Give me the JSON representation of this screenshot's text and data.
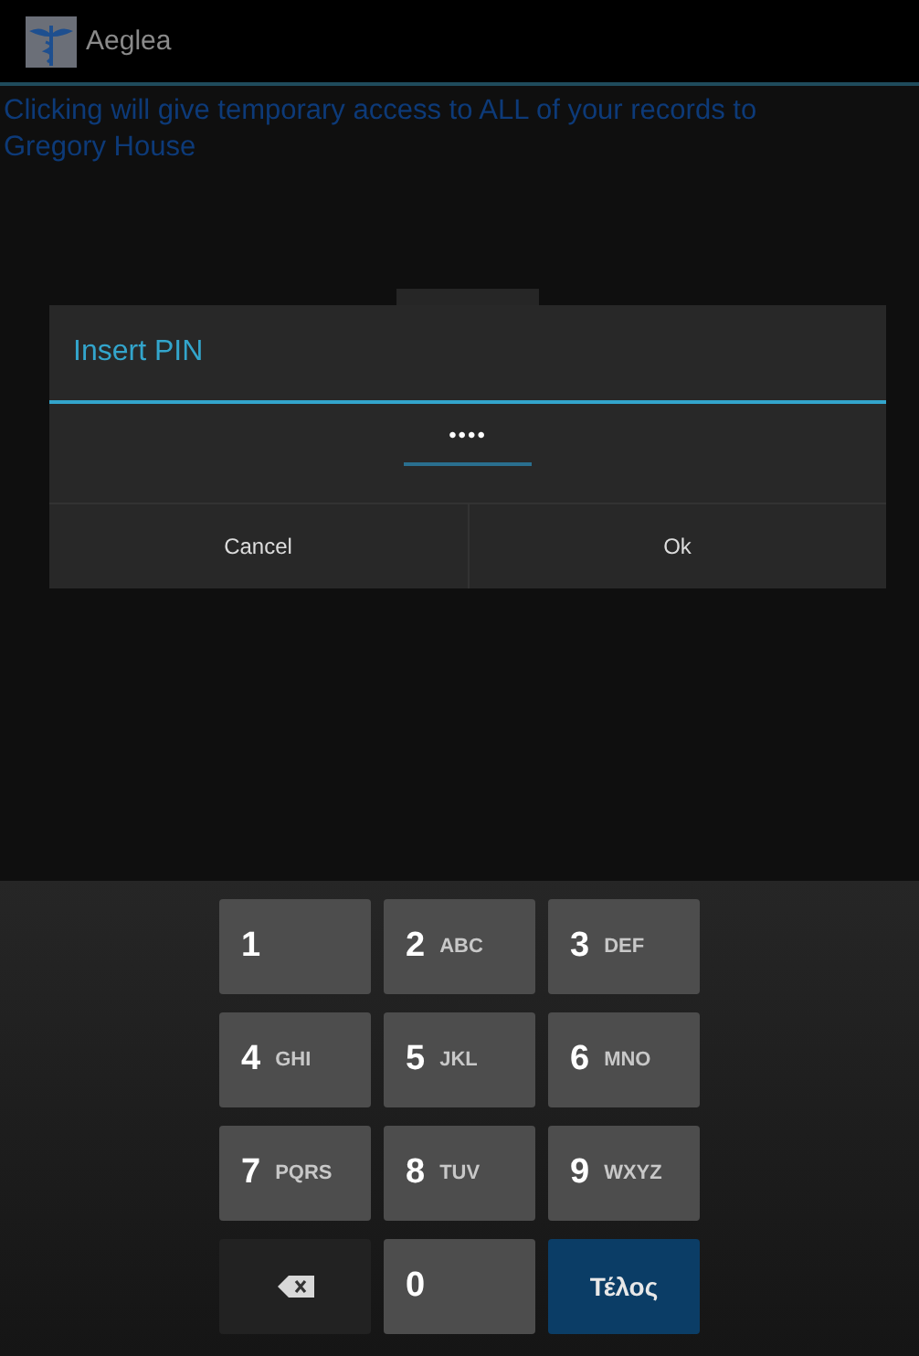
{
  "action_bar": {
    "title": "Aeglea"
  },
  "message": "Clicking will give temporary access to ALL of your records to Gregory House",
  "dialog": {
    "title": "Insert PIN",
    "pin_field": {
      "value": "••••"
    },
    "buttons": [
      "Cancel",
      "Ok"
    ]
  },
  "keypad": [
    {
      "kind": "digit",
      "label": "1"
    },
    {
      "kind": "digit",
      "label": "2",
      "letters": "ABC"
    },
    {
      "kind": "digit",
      "label": "3",
      "letters": "DEF"
    },
    {
      "kind": "digit",
      "label": "4",
      "letters": "GHI"
    },
    {
      "kind": "digit",
      "label": "5",
      "letters": "JKL"
    },
    {
      "kind": "digit",
      "label": "6",
      "letters": "MNO"
    },
    {
      "kind": "digit",
      "label": "7",
      "letters": "PQRS"
    },
    {
      "kind": "digit",
      "label": "8",
      "letters": "TUV"
    },
    {
      "kind": "digit",
      "label": "9",
      "letters": "WXYZ"
    },
    {
      "kind": "backspace"
    },
    {
      "kind": "digit",
      "label": "0"
    },
    {
      "kind": "done",
      "label": "Τέλος"
    }
  ]
}
